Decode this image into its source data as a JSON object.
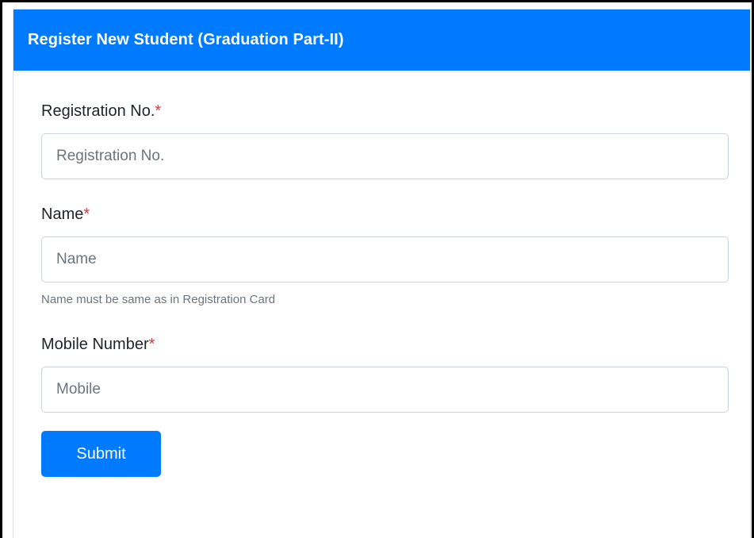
{
  "header": {
    "title": "Register New Student (Graduation Part-II)"
  },
  "form": {
    "registration": {
      "label": "Registration No.",
      "required_mark": "*",
      "placeholder": "Registration No.",
      "value": ""
    },
    "name": {
      "label": "Name",
      "required_mark": "*",
      "placeholder": "Name",
      "value": "",
      "help": "Name must be same as in Registration Card"
    },
    "mobile": {
      "label": "Mobile Number",
      "required_mark": "*",
      "placeholder": "Mobile",
      "value": ""
    },
    "submit_label": "Submit"
  },
  "colors": {
    "primary": "#007bff",
    "required": "#dc3545",
    "help_text": "#6c757d"
  }
}
